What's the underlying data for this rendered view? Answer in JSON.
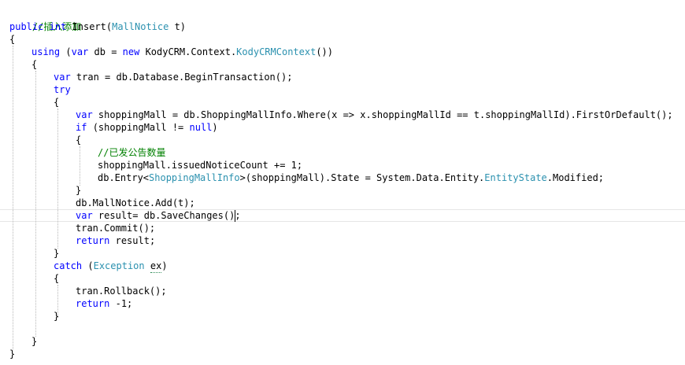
{
  "code": {
    "comment_insert": "//插入添加",
    "l1_public": "public",
    "l1_int": "int",
    "l1_insert": "Insert(",
    "l1_type": "MallNotice",
    "l1_param": " t)",
    "brace_open": "{",
    "brace_close": "}",
    "l3_using": "using",
    "l3_paren": "(",
    "l3_var": "var",
    "l3_db": "db =",
    "l3_new": "new",
    "l3_ns": "KodyCRM.Context.",
    "l3_ctx": "KodyCRMContext",
    "l3_end": "())",
    "l5_var": "var",
    "l5_rest": "tran = db.Database.BeginTransaction();",
    "l6_try": "try",
    "l8_var": "var",
    "l8_rest": "shoppingMall = db.ShoppingMallInfo.Where(x => x.shoppingMallId == t.shoppingMallId).FirstOrDefault();",
    "l9_if": "if",
    "l9_rest": "(shoppingMall !=",
    "l9_null": "null",
    "l9_end": ")",
    "comment_issued": "//已发公告数量",
    "l12_text": "shoppingMall.issuedNoticeCount += 1;",
    "l13_a": "db.Entry<",
    "l13_type": "ShoppingMallInfo",
    "l13_b": ">(shoppingMall).State = System.Data.Entity.",
    "l13_enum": "EntityState",
    "l13_c": ".Modified;",
    "l15_text": "db.MallNotice.Add(t);",
    "l16_var": "var",
    "l16_rest": "result= db.SaveChanges();",
    "l17_text": "tran.Commit();",
    "l18_return": "return",
    "l18_rest": "result;",
    "l20_catch": "catch",
    "l20_paren": "(",
    "l20_type": "Exception",
    "l20_ex": "ex",
    "l20_end": ")",
    "l22_text": "tran.Rollback();",
    "l23_return": "return",
    "l23_rest": "-1;"
  },
  "colors": {
    "keyword": "#0000ff",
    "type": "#2b91af",
    "comment": "#008000",
    "text": "#000000"
  }
}
